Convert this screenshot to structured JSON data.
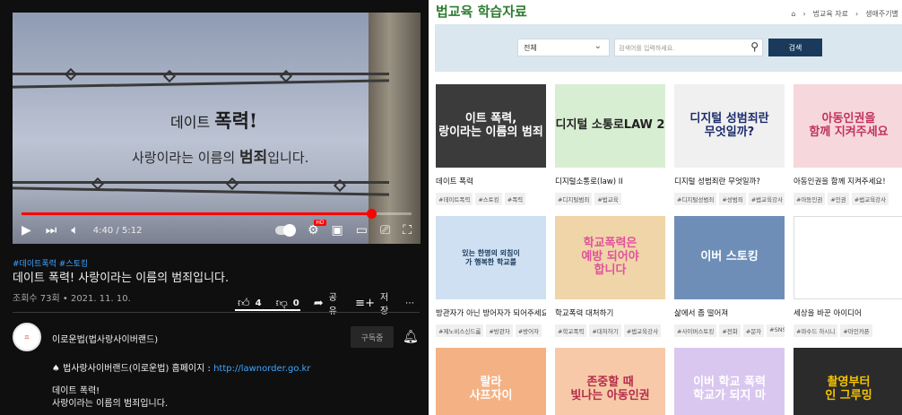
{
  "youtube": {
    "video": {
      "line1_pre": "데이트 ",
      "line1_big": "폭력!",
      "line2_pre": "사랑이라는 이름의 ",
      "line2_big": "범죄",
      "line2_post": "입니다.",
      "time": "4:40 / 5:12",
      "progress": 0.897
    },
    "tags": "#데이트폭력 #스토킹",
    "title": "데이트 폭력! 사랑이라는 이름의 범죄입니다.",
    "meta": "조회수 73회 • 2021. 11. 10.",
    "likes": "4",
    "dislikes": "0",
    "share": "공유",
    "save": "저장",
    "more": "⋯",
    "channel": "이로운법(법사랑사이버랜드)",
    "subscribe": "구독중",
    "desc_line1_prefix": "♠ 법사랑사이버랜드(이로운법) 홈페이지 : ",
    "desc_link": "http://lawnorder.go.kr",
    "desc_line2": "데이트 폭력!",
    "desc_line3": "사랑이라는 이름의 범죄입니다."
  },
  "library": {
    "title": "법교육 학습자료",
    "breadcrumb": [
      "법교육 자료",
      "생애주기별"
    ],
    "select_value": "전체",
    "search_placeholder": "검색어를 입력하세요.",
    "search_button": "검색",
    "cards": [
      {
        "title": "데이트 폭력",
        "tags": [
          "#데이트폭력",
          "#스토킹",
          "#폭력"
        ],
        "thumb": "이트 폭력,\n랑이라는 이름의 범죄"
      },
      {
        "title": "디지털소통로(law) II",
        "tags": [
          "#디지털범죄",
          "#법교육"
        ],
        "thumb": "디지털 소통로LAW 2"
      },
      {
        "title": "디지털 성범죄란 무엇일까?",
        "tags": [
          "#디지털성범죄",
          "#성범죄",
          "#법교육강사"
        ],
        "thumb": "디지털 성범죄란\n무엇일까?"
      },
      {
        "title": "아동인권을 함께 지켜주세요!",
        "tags": [
          "#아동인권",
          "#인권",
          "#법교육강사"
        ],
        "thumb": "아동인권을\n함께 지켜주세요"
      },
      {
        "title": "방관자가 아닌 방어자가 되어주세요!",
        "tags": [
          "#제노비스신드롬",
          "#방관자",
          "#방어자"
        ],
        "thumb": "있는 한명의 외침이\n가 행복한 학교를"
      },
      {
        "title": "학교폭력 대처하기",
        "tags": [
          "#학교폭력",
          "#대처하기",
          "#법교육강사"
        ],
        "thumb": "학교폭력은\n예방 되어야\n합니다"
      },
      {
        "title": "삶에서 좀 떨어져",
        "tags": [
          "#사이버스토킹",
          "#전화",
          "#문자",
          "#SNS"
        ],
        "thumb": "이버 스토킹"
      },
      {
        "title": "세상을 바꾼 아이디어",
        "tags": [
          "#마수드 하시니",
          "#마인카픈"
        ],
        "thumb": ""
      },
      {
        "title": "",
        "tags": [],
        "thumb": "랄라\n사프자이"
      },
      {
        "title": "",
        "tags": [],
        "thumb": "존중할 때\n빛나는 아동인권"
      },
      {
        "title": "",
        "tags": [],
        "thumb": "이버 학교 폭력\n학교가 되지 마"
      },
      {
        "title": "",
        "tags": [],
        "thumb": "촬영부터\n인 그루밍"
      }
    ]
  },
  "icons": {
    "play": "play-icon",
    "next": "next-icon",
    "volume": "volume-icon",
    "settings": "gear-icon"
  }
}
